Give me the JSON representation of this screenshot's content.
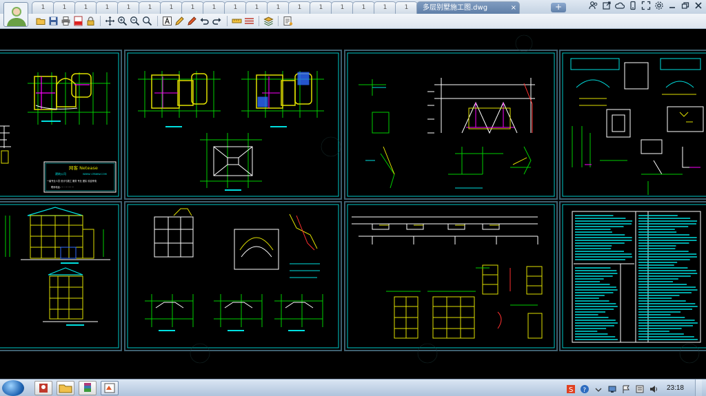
{
  "window": {
    "active_tab_title": "多层别墅施工图.dwg",
    "tab_close": "×",
    "new_tab": "+",
    "inactive_tab_count": 18,
    "inactive_tab_label": "1"
  },
  "toolbar": {
    "icons": [
      "open-icon",
      "save-icon",
      "print-icon",
      "pdf-icon",
      "lock-icon",
      "pan-icon",
      "zoom-in-icon",
      "zoom-out-icon",
      "zoom-window-icon",
      "text-icon",
      "pencil-icon",
      "highlighter-icon",
      "undo-icon",
      "redo-icon",
      "measure-icon",
      "layer-icon",
      "stack-icon",
      "info-icon"
    ]
  },
  "drawing": {
    "sheets": [
      {
        "name": "floor-plans-1",
        "has_title_block": true
      },
      {
        "name": "floor-plans-2"
      },
      {
        "name": "sections-details"
      },
      {
        "name": "eave-details"
      },
      {
        "name": "elevations"
      },
      {
        "name": "stair-sections"
      },
      {
        "name": "wall-details"
      },
      {
        "name": "notes-table"
      }
    ],
    "title_block": {
      "heading": "网客 Netease",
      "lines": [
        "建筑公司",
        "WWW.·LTBWW.COM",
        "一级专业人员 设计与施工 服务 专业 团队 欢迎来电",
        "联系电话: ··· · ··· ···· ···"
      ]
    },
    "colors": {
      "sheet_frame": "#00c8c8",
      "outer_frame": "#3f6070",
      "linework_yellow": "#e0e000",
      "linework_green": "#00d000",
      "linework_magenta": "#ff00ff",
      "linework_cyan": "#00e0e0",
      "linework_white": "#ffffff",
      "linework_red": "#ff3030",
      "linework_blue": "#2f6bff"
    }
  },
  "taskbar": {
    "clock": "23:18",
    "tray_icons": [
      "ime-s-icon",
      "help-icon",
      "network-icon",
      "tray-app-icon",
      "flag-icon",
      "volume-icon"
    ]
  }
}
